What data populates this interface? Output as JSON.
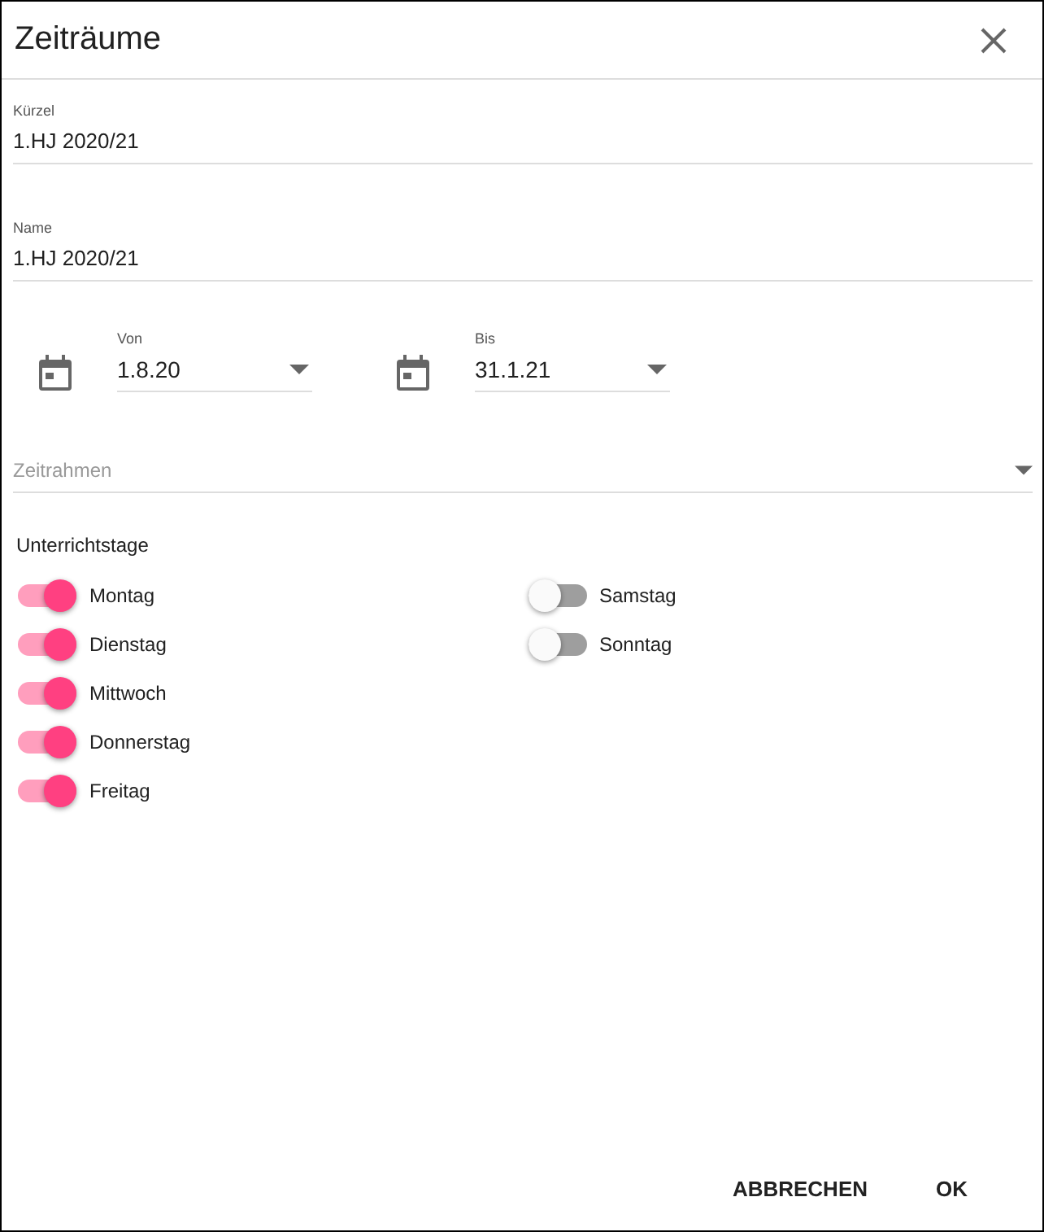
{
  "dialog": {
    "title": "Zeiträume"
  },
  "fields": [
    {
      "label": "Kürzel",
      "value": "1.HJ 2020/21"
    },
    {
      "label": "Name",
      "value": "1.HJ 2020/21"
    }
  ],
  "dates": [
    {
      "label": "Von",
      "value": "1.8.20"
    },
    {
      "label": "Bis",
      "value": "31.1.21"
    }
  ],
  "timeframe": {
    "placeholder": "Zeitrahmen"
  },
  "lesson_days": {
    "heading": "Unterrichtstage",
    "columns": [
      {
        "days": [
          {
            "label": "Montag",
            "on": true
          },
          {
            "label": "Dienstag",
            "on": true
          },
          {
            "label": "Mittwoch",
            "on": true
          },
          {
            "label": "Donnerstag",
            "on": true
          },
          {
            "label": "Freitag",
            "on": true
          }
        ]
      },
      {
        "days": [
          {
            "label": "Samstag",
            "on": false
          },
          {
            "label": "Sonntag",
            "on": false
          }
        ]
      }
    ]
  },
  "buttons": [
    {
      "label": "ABBRECHEN"
    },
    {
      "label": "OK"
    }
  ]
}
